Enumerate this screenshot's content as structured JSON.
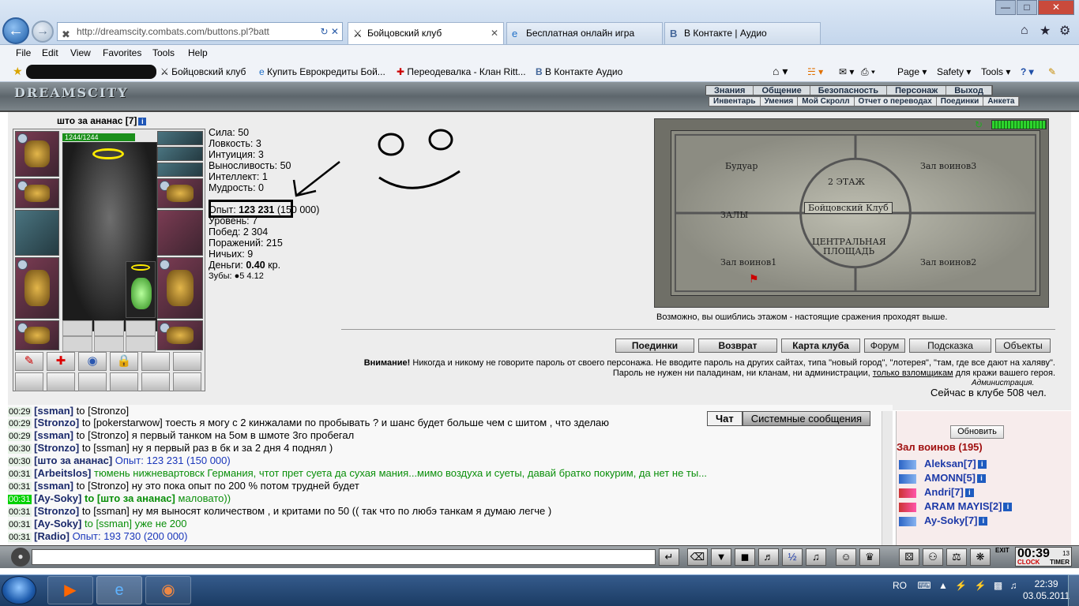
{
  "browser": {
    "address": "http://dreamscity.combats.com/buttons.pl?batt",
    "tabs": [
      {
        "label": "Бойцовский клуб",
        "active": true
      },
      {
        "label": "Бесплатная онлайн игра",
        "active": false
      },
      {
        "label": "В Контакте | Аудио",
        "active": false
      }
    ],
    "menu": [
      "File",
      "Edit",
      "View",
      "Favorites",
      "Tools",
      "Help"
    ],
    "favorites": [
      "Бойцовский клуб",
      "Купить Еврокредиты Бой...",
      "Переодевалка - Клан Ritt...",
      "В Контакте  Аудио"
    ],
    "cmd": [
      "Page",
      "Safety",
      "Tools"
    ]
  },
  "game": {
    "logo": "DREAMSCITY",
    "top_menu": [
      "Знания",
      "Общение",
      "Безопасность",
      "Персонаж",
      "Выход"
    ],
    "sub_menu": [
      "Инвентарь",
      "Умения",
      "Мой Скролл",
      "Отчет о переводах",
      "Поединки",
      "Анкета"
    ],
    "char_name": "што за ананас",
    "char_level": "[7]",
    "hp": "1244/1244",
    "stats": [
      {
        "label": "Сила:",
        "value": "50"
      },
      {
        "label": "Ловкость:",
        "value": "3"
      },
      {
        "label": "Интуиция:",
        "value": "3"
      },
      {
        "label": "Выносливость:",
        "value": "50"
      },
      {
        "label": "Интеллект:",
        "value": "1"
      },
      {
        "label": "Мудрость:",
        "value": "0"
      }
    ],
    "exp_label": "Опыт:",
    "exp_value": "123 231",
    "exp_next": "(150 000)",
    "level": "Уровень: 7",
    "wins": "Побед: 2 304",
    "losses": "Поражений: 215",
    "draws": "Ничьих: 9",
    "money_label": "Деньги:",
    "money_value": "0.40",
    "money_unit": "кр.",
    "teeth": "Зубы:",
    "teeth_values": "5  4.12",
    "map": {
      "labels": [
        "Будуар",
        "Зал воинов3",
        "2 ЭТАЖ",
        "Бойцовский Клуб",
        "ЗАЛЫ",
        "ЦЕНТРАЛЬНАЯ",
        "ПЛОЩАДЬ",
        "Зал воинов1",
        "Зал воинов2"
      ],
      "hint": "Возможно, вы ошиблись этажом - настоящие сражения проходят выше."
    },
    "buttons": [
      "Поединки",
      "Возврат",
      "Карта клуба",
      "Форум",
      "Подсказка",
      "Объекты"
    ],
    "warning_bold": "Внимание!",
    "warning_text": " Никогда и никому не говорите пароль от своего персонажа. Не вводите пароль на других сайтах, типа \"новый город\", \"лотерея\", \"там, где все дают на халяву\". Пароль не нужен ни паладинам, ни кланам, ни администрации, ",
    "warning_link": "только взломщикам",
    "warning_tail": " для кражи вашего героя.",
    "admin": "Администрация.",
    "online": "Сейчас в клубе 508 чел."
  },
  "chat": {
    "tabs": [
      "Чат",
      "Системные сообщения"
    ],
    "lines": [
      {
        "time": "00:29",
        "nick": "[ssman]",
        "to": "to [Stronzo]",
        "text": "",
        "style": "normal",
        "hl": false
      },
      {
        "time": "00:29",
        "nick": "[Stronzo]",
        "to": "to [pokerstarwow]",
        "text": "тоесть я могу с 2 кинжалами по пробывать ? и шанс будет больше чем с шитом , что зделаю",
        "style": "normal",
        "hl": false
      },
      {
        "time": "00:29",
        "nick": "[ssman]",
        "to": "to [Stronzo]",
        "text": "я первый танком на 5ом в шмоте 3го пробегал",
        "style": "normal",
        "hl": false
      },
      {
        "time": "00:30",
        "nick": "[Stronzo]",
        "to": "to [ssman]",
        "text": "ну я первый раз в бк и за 2 дня 4 поднял )",
        "style": "normal",
        "hl": false
      },
      {
        "time": "00:30",
        "nick": "[што за ананас]",
        "to": "",
        "text": "Опыт: 123 231 (150 000)",
        "style": "blue",
        "hl": false
      },
      {
        "time": "00:31",
        "nick": "[Arbeitslos]",
        "to": "",
        "text": "тюмень нижневартовск Германия, чтот прет суета да сухая мания...мимо воздуха и суеты, давай братко покурим, да нет не ты...",
        "style": "green",
        "hl": false
      },
      {
        "time": "00:31",
        "nick": "[ssman]",
        "to": "to [Stronzo]",
        "text": "ну это пока опыт по 200 % потом трудней будет",
        "style": "normal",
        "hl": false
      },
      {
        "time": "00:31",
        "nick": "[Ay-Soky]",
        "to": "to [што за ананас]",
        "text": "маловато))",
        "style": "green",
        "hl": true
      },
      {
        "time": "00:31",
        "nick": "[Stronzo]",
        "to": "to [ssman]",
        "text": "ну мя выносят количеством , и критами по 50 (( так что по любэ танкам я думаю легче )",
        "style": "normal",
        "hl": false
      },
      {
        "time": "00:31",
        "nick": "[Ay-Soky]",
        "to": "to [ssman]",
        "text": "уже не 200",
        "style": "green",
        "hl": false
      },
      {
        "time": "00:31",
        "nick": "[Radio]",
        "to": "",
        "text": "Опыт: 193 730 (200 000)",
        "style": "blue",
        "hl": false
      }
    ]
  },
  "room": {
    "refresh": "Обновить",
    "name": "Зал воинов (195)",
    "players": [
      {
        "name": "Aleksan",
        "lvl": "[7]"
      },
      {
        "name": "AMONN",
        "lvl": "[5]"
      },
      {
        "name": "Andri",
        "lvl": "[7]"
      },
      {
        "name": "ARAM MAYIS",
        "lvl": "[2]"
      },
      {
        "name": "Ay-Soky",
        "lvl": "[7]"
      }
    ]
  },
  "timer": {
    "value": "00:39",
    "sec": "13",
    "clock_lbl": "CLOCK",
    "timer_lbl": "TIMER",
    "exit": "EXIT"
  },
  "taskbar": {
    "lang": "RO",
    "time": "22:39",
    "date": "03.05.2011"
  }
}
